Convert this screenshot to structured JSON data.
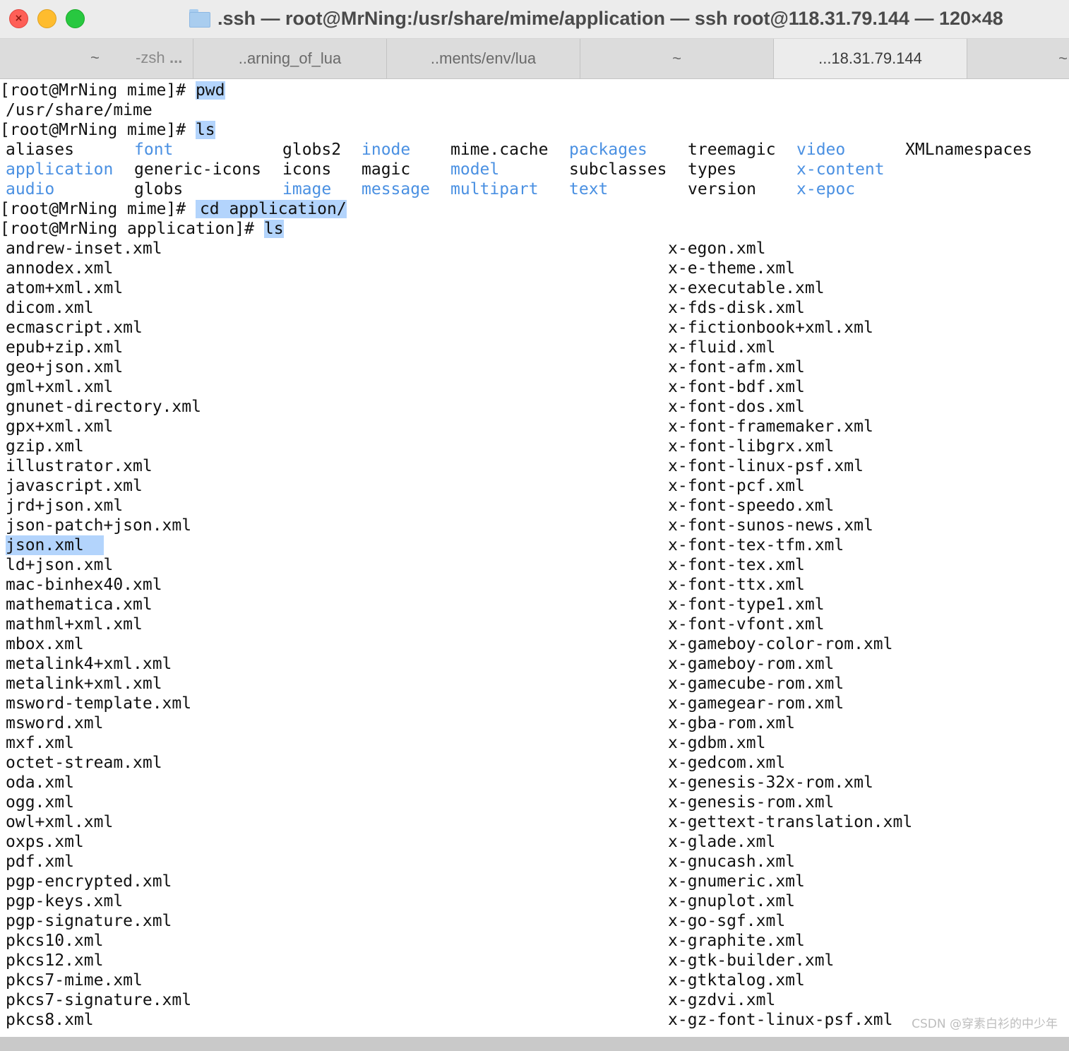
{
  "window": {
    "title": ".ssh — root@MrNing:/usr/share/mime/application — ssh root@118.31.79.144 — 120×48"
  },
  "tabs": [
    {
      "label": "~",
      "sub": "-zsh",
      "dots": "...",
      "active": false
    },
    {
      "label": "..arning_of_lua",
      "active": false
    },
    {
      "label": "..ments/env/lua",
      "active": false
    },
    {
      "label": "~",
      "active": false
    },
    {
      "label": "...18.31.79.144",
      "active": true
    },
    {
      "label": "~",
      "active": false
    }
  ],
  "terminal": {
    "prompt_mime": "[root@MrNing mime]# ",
    "prompt_app": "[root@MrNing application]# ",
    "cmd_pwd": "pwd",
    "out_pwd": "/usr/share/mime",
    "cmd_ls": "ls",
    "cmd_cd": "cd application/",
    "cmd_ls2": "ls",
    "ls_mime": [
      {
        "name": "aliases",
        "dir": false
      },
      {
        "name": "font",
        "dir": true
      },
      {
        "name": "globs2",
        "dir": false
      },
      {
        "name": "inode",
        "dir": true
      },
      {
        "name": "mime.cache",
        "dir": false
      },
      {
        "name": "packages",
        "dir": true
      },
      {
        "name": "treemagic",
        "dir": false
      },
      {
        "name": "video",
        "dir": true
      },
      {
        "name": "XMLnamespaces",
        "dir": false
      },
      {
        "name": "application",
        "dir": true
      },
      {
        "name": "generic-icons",
        "dir": false
      },
      {
        "name": "icons",
        "dir": false
      },
      {
        "name": "magic",
        "dir": false
      },
      {
        "name": "model",
        "dir": true
      },
      {
        "name": "subclasses",
        "dir": false
      },
      {
        "name": "types",
        "dir": false
      },
      {
        "name": "x-content",
        "dir": true
      },
      {
        "name": "audio",
        "dir": true
      },
      {
        "name": "globs",
        "dir": false
      },
      {
        "name": "image",
        "dir": true
      },
      {
        "name": "message",
        "dir": true
      },
      {
        "name": "multipart",
        "dir": true
      },
      {
        "name": "text",
        "dir": true
      },
      {
        "name": "version",
        "dir": false
      },
      {
        "name": "x-epoc",
        "dir": true
      }
    ],
    "ls_app_left": [
      "andrew-inset.xml",
      "annodex.xml",
      "atom+xml.xml",
      "dicom.xml",
      "ecmascript.xml",
      "epub+zip.xml",
      "geo+json.xml",
      "gml+xml.xml",
      "gnunet-directory.xml",
      "gpx+xml.xml",
      "gzip.xml",
      "illustrator.xml",
      "javascript.xml",
      "jrd+json.xml",
      "json-patch+json.xml",
      "json.xml",
      "ld+json.xml",
      "mac-binhex40.xml",
      "mathematica.xml",
      "mathml+xml.xml",
      "mbox.xml",
      "metalink4+xml.xml",
      "metalink+xml.xml",
      "msword-template.xml",
      "msword.xml",
      "mxf.xml",
      "octet-stream.xml",
      "oda.xml",
      "ogg.xml",
      "owl+xml.xml",
      "oxps.xml",
      "pdf.xml",
      "pgp-encrypted.xml",
      "pgp-keys.xml",
      "pgp-signature.xml",
      "pkcs10.xml",
      "pkcs12.xml",
      "pkcs7-mime.xml",
      "pkcs7-signature.xml",
      "pkcs8.xml"
    ],
    "ls_app_right": [
      "x-egon.xml",
      "x-e-theme.xml",
      "x-executable.xml",
      "x-fds-disk.xml",
      "x-fictionbook+xml.xml",
      "x-fluid.xml",
      "x-font-afm.xml",
      "x-font-bdf.xml",
      "x-font-dos.xml",
      "x-font-framemaker.xml",
      "x-font-libgrx.xml",
      "x-font-linux-psf.xml",
      "x-font-pcf.xml",
      "x-font-speedo.xml",
      "x-font-sunos-news.xml",
      "x-font-tex-tfm.xml",
      "x-font-tex.xml",
      "x-font-ttx.xml",
      "x-font-type1.xml",
      "x-font-vfont.xml",
      "x-gameboy-color-rom.xml",
      "x-gameboy-rom.xml",
      "x-gamecube-rom.xml",
      "x-gamegear-rom.xml",
      "x-gba-rom.xml",
      "x-gdbm.xml",
      "x-gedcom.xml",
      "x-genesis-32x-rom.xml",
      "x-genesis-rom.xml",
      "x-gettext-translation.xml",
      "x-glade.xml",
      "x-gnucash.xml",
      "x-gnumeric.xml",
      "x-gnuplot.xml",
      "x-go-sgf.xml",
      "x-graphite.xml",
      "x-gtk-builder.xml",
      "x-gtktalog.xml",
      "x-gzdvi.xml",
      "x-gz-font-linux-psf.xml"
    ],
    "selected_file": "json.xml"
  },
  "watermark": "CSDN @穿素白衫的中少年",
  "colors": {
    "dir": "#4a90e2",
    "selection": "#b3d4fc",
    "close": "#fe5f57",
    "minimize": "#febc2e",
    "zoom": "#28c840"
  }
}
